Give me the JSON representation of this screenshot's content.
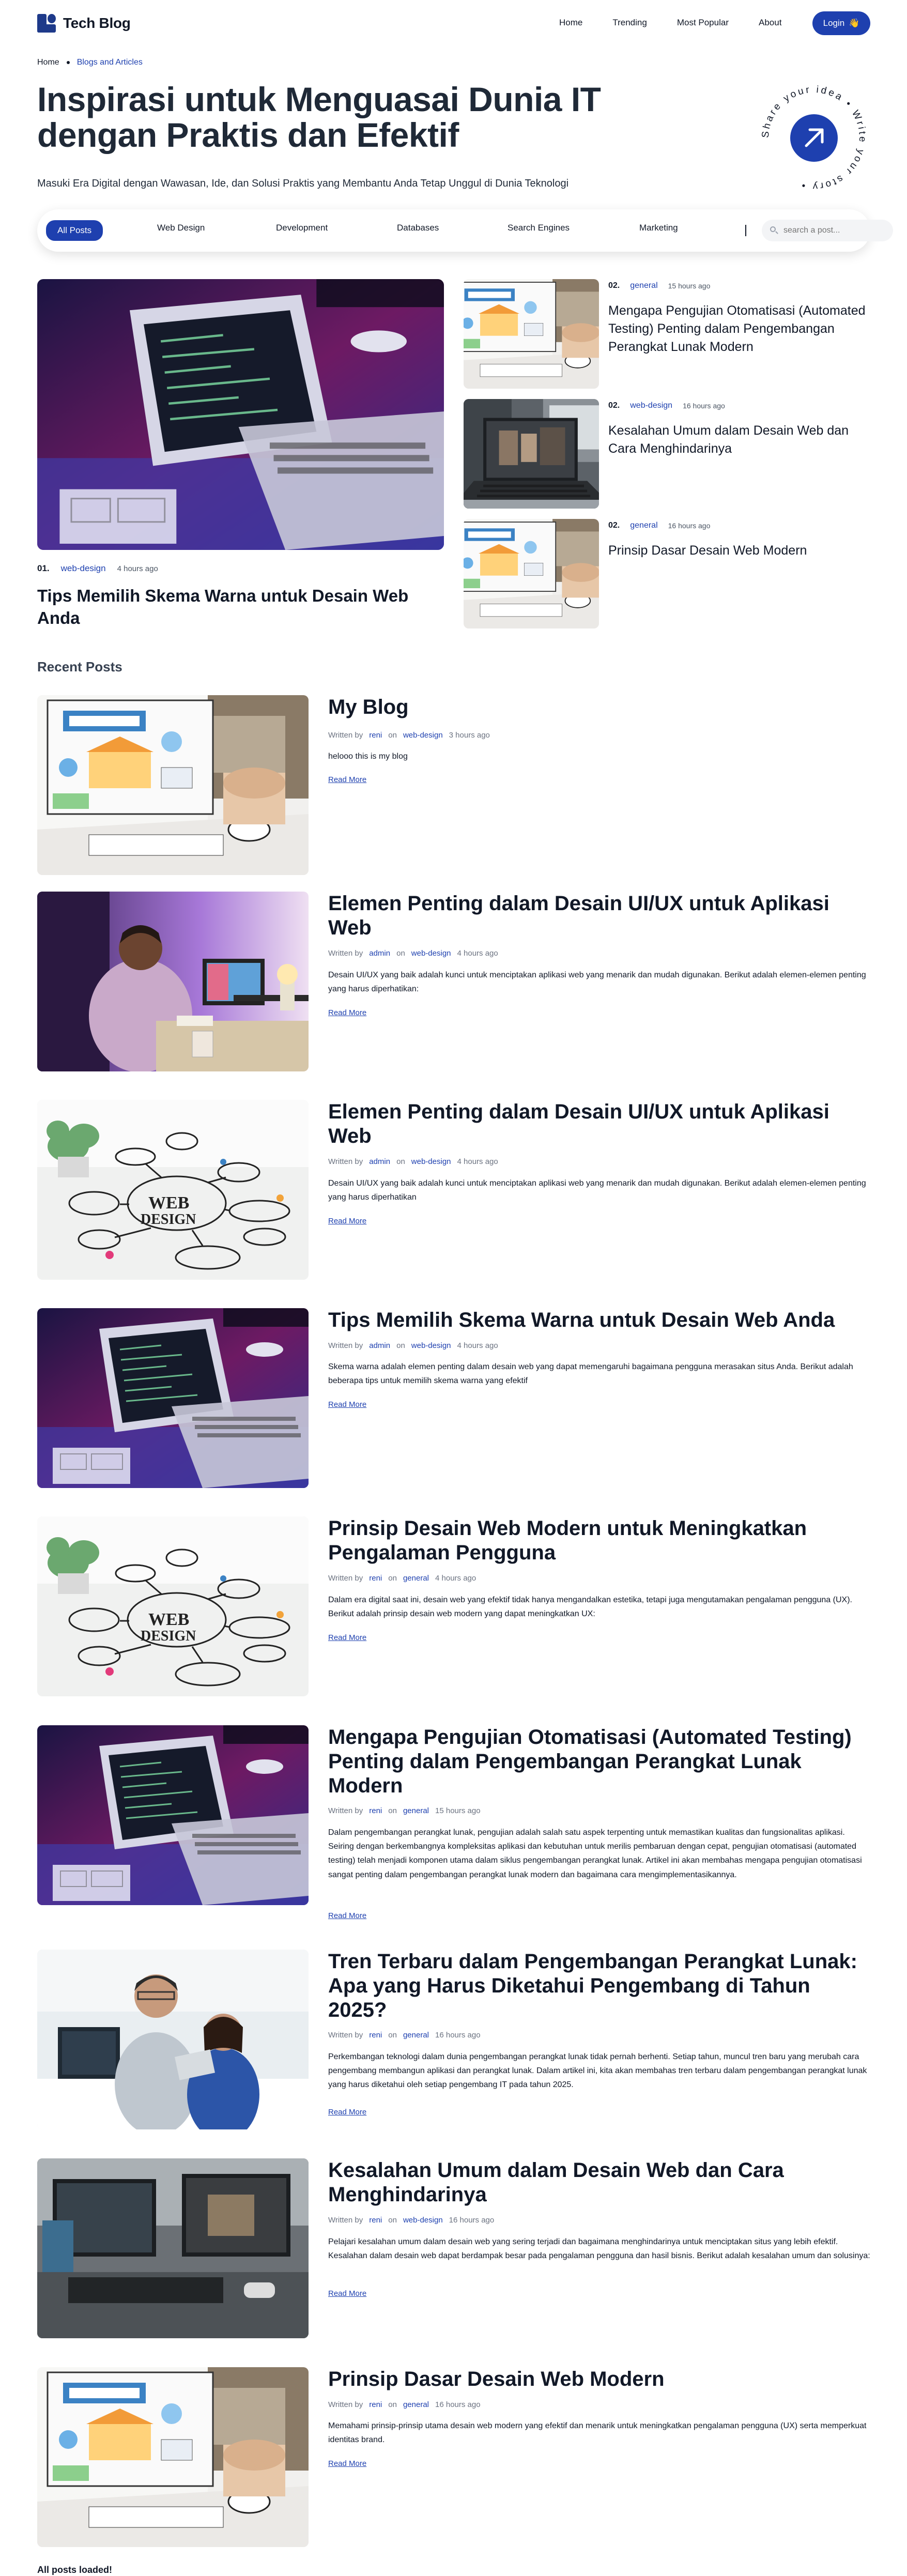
{
  "brand": {
    "name": "Tech Blog"
  },
  "nav": {
    "links": [
      "Home",
      "Trending",
      "Most Popular",
      "About"
    ],
    "login_label": "Login",
    "login_icon": "waving-hand-icon"
  },
  "breadcrumb": {
    "items": [
      "Home",
      "Blogs and Articles"
    ]
  },
  "hero": {
    "title": "Inspirasi untuk Menguasai Dunia IT dengan Praktis dan Efektif",
    "subtitle": "Masuki Era Digital dengan Wawasan, Ide, dan Solusi Praktis yang Membantu Anda Tetap Unggul di Dunia Teknologi",
    "badge_text": "Share your idea • Write your story •"
  },
  "filters": {
    "categories": [
      "All Posts",
      "Web Design",
      "Development",
      "Databases",
      "Search Engines",
      "Marketing"
    ],
    "active": "All Posts",
    "search_placeholder": "search a post..."
  },
  "featured": {
    "main": {
      "num": "01.",
      "category": "web-design",
      "time": "4 hours ago",
      "title": "Tips Memilih Skema Warna untuk Desain Web Anda"
    },
    "side": [
      {
        "num": "02.",
        "category": "general",
        "time": "15 hours ago",
        "title": "Mengapa Pengujian Otomatisasi (Automated Testing) Penting dalam Pengembangan Perangkat Lunak Modern"
      },
      {
        "num": "02.",
        "category": "web-design",
        "time": "16 hours ago",
        "title": "Kesalahan Umum dalam Desain Web dan Cara Menghindarinya"
      },
      {
        "num": "02.",
        "category": "general",
        "time": "16 hours ago",
        "title": "Prinsip Dasar Desain Web Modern"
      }
    ]
  },
  "recent": {
    "heading": "Recent Posts",
    "written_by": "Written by",
    "on": "on",
    "read_more": "Read More",
    "posts": [
      {
        "title": "My Blog",
        "author": "reni",
        "category": "web-design",
        "time": "3 hours ago",
        "excerpt": "helooo this is my blog"
      },
      {
        "title": "Elemen Penting dalam Desain UI/UX untuk Aplikasi Web",
        "author": "admin",
        "category": "web-design",
        "time": "4 hours ago",
        "excerpt": "Desain UI/UX yang baik adalah kunci untuk menciptakan aplikasi web yang menarik dan mudah digunakan. Berikut adalah elemen-elemen penting yang harus diperhatikan:"
      },
      {
        "title": "Elemen Penting dalam Desain UI/UX untuk Aplikasi Web",
        "author": "admin",
        "category": "web-design",
        "time": "4 hours ago",
        "excerpt": "Desain UI/UX yang baik adalah kunci untuk menciptakan aplikasi web yang menarik dan mudah digunakan. Berikut adalah elemen-elemen penting yang harus diperhatikan"
      },
      {
        "title": "Tips Memilih Skema Warna untuk Desain Web Anda",
        "author": "admin",
        "category": "web-design",
        "time": "4 hours ago",
        "excerpt": "Skema warna adalah elemen penting dalam desain web yang dapat memengaruhi bagaimana pengguna merasakan situs Anda. Berikut adalah beberapa tips untuk memilih skema warna yang efektif"
      },
      {
        "title": "Prinsip Desain Web Modern untuk Meningkatkan Pengalaman Pengguna",
        "author": "reni",
        "category": "general",
        "time": "4 hours ago",
        "excerpt": "Dalam era digital saat ini, desain web yang efektif tidak hanya mengandalkan estetika, tetapi juga mengutamakan pengalaman pengguna (UX). Berikut adalah prinsip desain web modern yang dapat meningkatkan UX:"
      },
      {
        "title": "Mengapa Pengujian Otomatisasi (Automated Testing) Penting dalam Pengembangan Perangkat Lunak Modern",
        "author": "reni",
        "category": "general",
        "time": "15 hours ago",
        "excerpt": "Dalam pengembangan perangkat lunak, pengujian adalah salah satu aspek terpenting untuk memastikan kualitas dan fungsionalitas aplikasi. Seiring dengan berkembangnya kompleksitas aplikasi dan kebutuhan untuk merilis pembaruan dengan cepat, pengujian otomatisasi (automated testing) telah menjadi komponen utama dalam siklus pengembangan perangkat lunak. Artikel ini akan membahas mengapa pengujian otomatisasi sangat penting dalam pengembangan perangkat lunak modern dan bagaimana cara mengimplementasikannya."
      },
      {
        "title": "Tren Terbaru dalam Pengembangan Perangkat Lunak: Apa yang Harus Diketahui Pengembang di Tahun 2025?",
        "author": "reni",
        "category": "general",
        "time": "16 hours ago",
        "excerpt": "Perkembangan teknologi dalam dunia pengembangan perangkat lunak tidak pernah berhenti. Setiap tahun, muncul tren baru yang merubah cara pengembang membangun aplikasi dan perangkat lunak. Dalam artikel ini, kita akan membahas tren terbaru dalam pengembangan perangkat lunak yang harus diketahui oleh setiap pengembang IT pada tahun 2025."
      },
      {
        "title": "Kesalahan Umum dalam Desain Web dan Cara Menghindarinya",
        "author": "reni",
        "category": "web-design",
        "time": "16 hours ago",
        "excerpt": "Pelajari kesalahan umum dalam desain web yang sering terjadi dan bagaimana menghindarinya untuk menciptakan situs yang lebih efektif. Kesalahan dalam desain web dapat berdampak besar pada pengalaman pengguna dan hasil bisnis. Berikut adalah kesalahan umum dan solusinya:"
      },
      {
        "title": "Prinsip Dasar Desain Web Modern",
        "author": "reni",
        "category": "general",
        "time": "16 hours ago",
        "excerpt": "Memahami prinsip-prinsip utama desain web modern yang efektif dan menarik untuk meningkatkan pengalaman pengguna (UX) serta memperkuat identitas brand."
      }
    ]
  },
  "footer": {
    "loaded_text": "All posts loaded!"
  },
  "colors": {
    "accent": "#1e40af",
    "text": "#111827",
    "muted": "#6b7280"
  }
}
